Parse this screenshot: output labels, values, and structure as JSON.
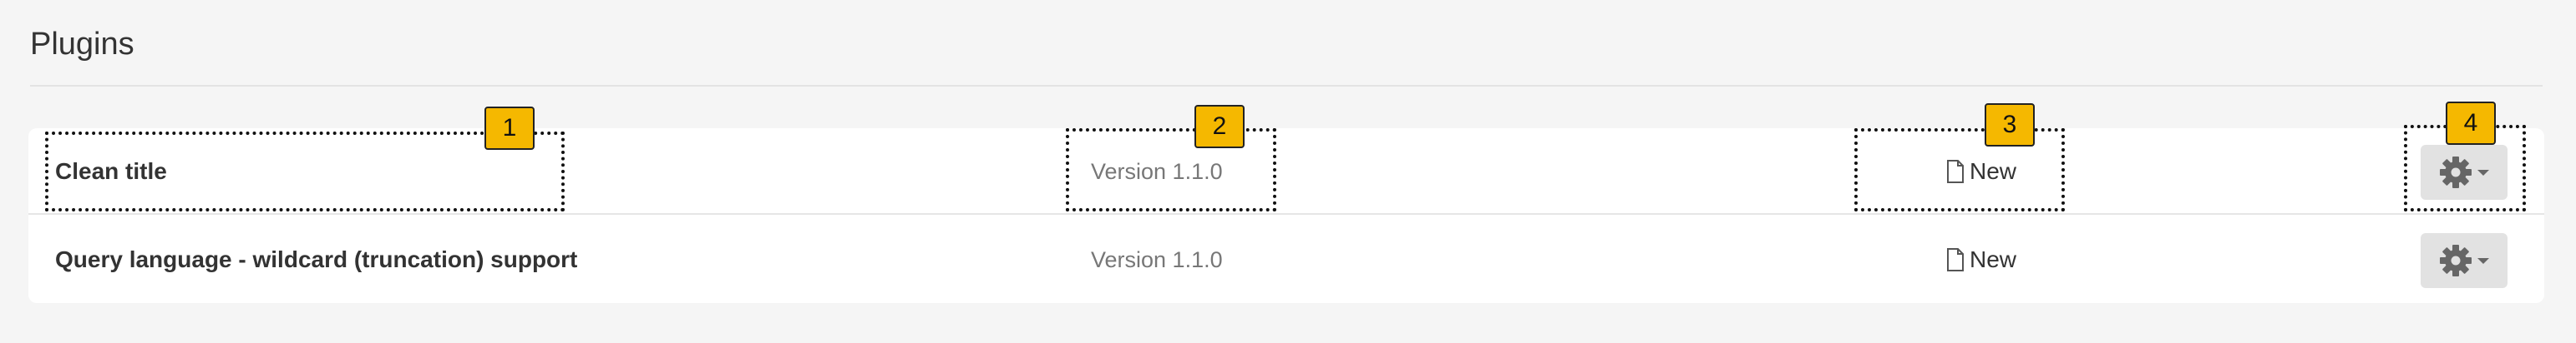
{
  "header": {
    "title": "Plugins"
  },
  "plugins": [
    {
      "name": "Clean title",
      "version": "Version 1.1.0",
      "status": "New",
      "status_icon": "document-icon",
      "action_icon": "gear-icon"
    },
    {
      "name": "Query language - wildcard (truncation) support",
      "version": "Version 1.1.0",
      "status": "New",
      "status_icon": "document-icon",
      "action_icon": "gear-icon"
    }
  ],
  "annotations": [
    "1",
    "2",
    "3",
    "4"
  ],
  "colors": {
    "badge": "#f5b800",
    "panel": "#ffffff",
    "background": "#f5f5f5",
    "button": "#e2e2e2"
  }
}
